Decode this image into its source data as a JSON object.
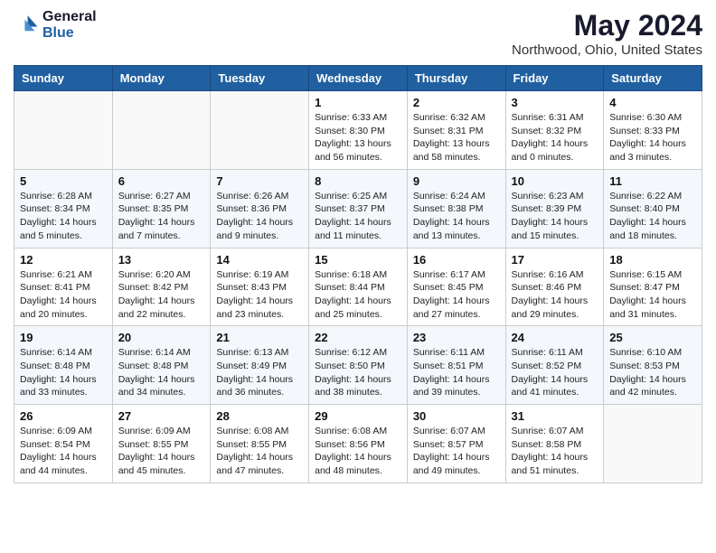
{
  "header": {
    "logo_general": "General",
    "logo_blue": "Blue",
    "title": "May 2024",
    "location": "Northwood, Ohio, United States"
  },
  "weekdays": [
    "Sunday",
    "Monday",
    "Tuesday",
    "Wednesday",
    "Thursday",
    "Friday",
    "Saturday"
  ],
  "weeks": [
    [
      {
        "day": "",
        "info": ""
      },
      {
        "day": "",
        "info": ""
      },
      {
        "day": "",
        "info": ""
      },
      {
        "day": "1",
        "info": "Sunrise: 6:33 AM\nSunset: 8:30 PM\nDaylight: 13 hours\nand 56 minutes."
      },
      {
        "day": "2",
        "info": "Sunrise: 6:32 AM\nSunset: 8:31 PM\nDaylight: 13 hours\nand 58 minutes."
      },
      {
        "day": "3",
        "info": "Sunrise: 6:31 AM\nSunset: 8:32 PM\nDaylight: 14 hours\nand 0 minutes."
      },
      {
        "day": "4",
        "info": "Sunrise: 6:30 AM\nSunset: 8:33 PM\nDaylight: 14 hours\nand 3 minutes."
      }
    ],
    [
      {
        "day": "5",
        "info": "Sunrise: 6:28 AM\nSunset: 8:34 PM\nDaylight: 14 hours\nand 5 minutes."
      },
      {
        "day": "6",
        "info": "Sunrise: 6:27 AM\nSunset: 8:35 PM\nDaylight: 14 hours\nand 7 minutes."
      },
      {
        "day": "7",
        "info": "Sunrise: 6:26 AM\nSunset: 8:36 PM\nDaylight: 14 hours\nand 9 minutes."
      },
      {
        "day": "8",
        "info": "Sunrise: 6:25 AM\nSunset: 8:37 PM\nDaylight: 14 hours\nand 11 minutes."
      },
      {
        "day": "9",
        "info": "Sunrise: 6:24 AM\nSunset: 8:38 PM\nDaylight: 14 hours\nand 13 minutes."
      },
      {
        "day": "10",
        "info": "Sunrise: 6:23 AM\nSunset: 8:39 PM\nDaylight: 14 hours\nand 15 minutes."
      },
      {
        "day": "11",
        "info": "Sunrise: 6:22 AM\nSunset: 8:40 PM\nDaylight: 14 hours\nand 18 minutes."
      }
    ],
    [
      {
        "day": "12",
        "info": "Sunrise: 6:21 AM\nSunset: 8:41 PM\nDaylight: 14 hours\nand 20 minutes."
      },
      {
        "day": "13",
        "info": "Sunrise: 6:20 AM\nSunset: 8:42 PM\nDaylight: 14 hours\nand 22 minutes."
      },
      {
        "day": "14",
        "info": "Sunrise: 6:19 AM\nSunset: 8:43 PM\nDaylight: 14 hours\nand 23 minutes."
      },
      {
        "day": "15",
        "info": "Sunrise: 6:18 AM\nSunset: 8:44 PM\nDaylight: 14 hours\nand 25 minutes."
      },
      {
        "day": "16",
        "info": "Sunrise: 6:17 AM\nSunset: 8:45 PM\nDaylight: 14 hours\nand 27 minutes."
      },
      {
        "day": "17",
        "info": "Sunrise: 6:16 AM\nSunset: 8:46 PM\nDaylight: 14 hours\nand 29 minutes."
      },
      {
        "day": "18",
        "info": "Sunrise: 6:15 AM\nSunset: 8:47 PM\nDaylight: 14 hours\nand 31 minutes."
      }
    ],
    [
      {
        "day": "19",
        "info": "Sunrise: 6:14 AM\nSunset: 8:48 PM\nDaylight: 14 hours\nand 33 minutes."
      },
      {
        "day": "20",
        "info": "Sunrise: 6:14 AM\nSunset: 8:48 PM\nDaylight: 14 hours\nand 34 minutes."
      },
      {
        "day": "21",
        "info": "Sunrise: 6:13 AM\nSunset: 8:49 PM\nDaylight: 14 hours\nand 36 minutes."
      },
      {
        "day": "22",
        "info": "Sunrise: 6:12 AM\nSunset: 8:50 PM\nDaylight: 14 hours\nand 38 minutes."
      },
      {
        "day": "23",
        "info": "Sunrise: 6:11 AM\nSunset: 8:51 PM\nDaylight: 14 hours\nand 39 minutes."
      },
      {
        "day": "24",
        "info": "Sunrise: 6:11 AM\nSunset: 8:52 PM\nDaylight: 14 hours\nand 41 minutes."
      },
      {
        "day": "25",
        "info": "Sunrise: 6:10 AM\nSunset: 8:53 PM\nDaylight: 14 hours\nand 42 minutes."
      }
    ],
    [
      {
        "day": "26",
        "info": "Sunrise: 6:09 AM\nSunset: 8:54 PM\nDaylight: 14 hours\nand 44 minutes."
      },
      {
        "day": "27",
        "info": "Sunrise: 6:09 AM\nSunset: 8:55 PM\nDaylight: 14 hours\nand 45 minutes."
      },
      {
        "day": "28",
        "info": "Sunrise: 6:08 AM\nSunset: 8:55 PM\nDaylight: 14 hours\nand 47 minutes."
      },
      {
        "day": "29",
        "info": "Sunrise: 6:08 AM\nSunset: 8:56 PM\nDaylight: 14 hours\nand 48 minutes."
      },
      {
        "day": "30",
        "info": "Sunrise: 6:07 AM\nSunset: 8:57 PM\nDaylight: 14 hours\nand 49 minutes."
      },
      {
        "day": "31",
        "info": "Sunrise: 6:07 AM\nSunset: 8:58 PM\nDaylight: 14 hours\nand 51 minutes."
      },
      {
        "day": "",
        "info": ""
      }
    ]
  ]
}
